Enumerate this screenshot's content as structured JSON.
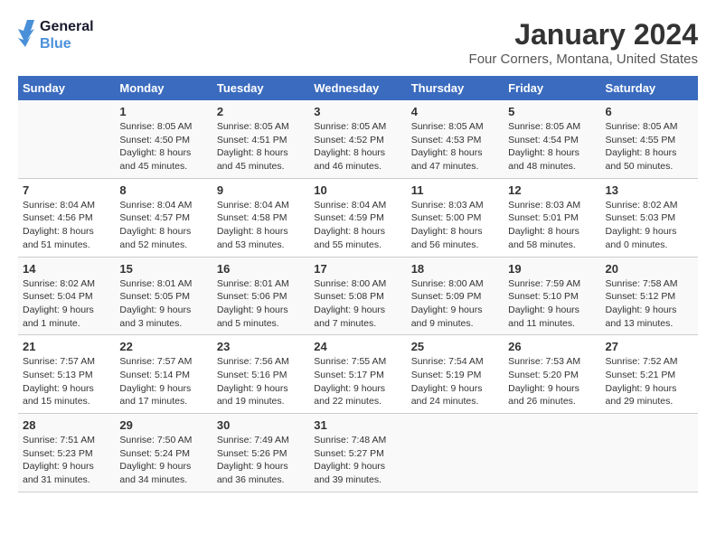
{
  "header": {
    "logo_line1": "General",
    "logo_line2": "Blue",
    "title": "January 2024",
    "subtitle": "Four Corners, Montana, United States"
  },
  "weekdays": [
    "Sunday",
    "Monday",
    "Tuesday",
    "Wednesday",
    "Thursday",
    "Friday",
    "Saturday"
  ],
  "weeks": [
    [
      {
        "day": "",
        "info": ""
      },
      {
        "day": "1",
        "info": "Sunrise: 8:05 AM\nSunset: 4:50 PM\nDaylight: 8 hours\nand 45 minutes."
      },
      {
        "day": "2",
        "info": "Sunrise: 8:05 AM\nSunset: 4:51 PM\nDaylight: 8 hours\nand 45 minutes."
      },
      {
        "day": "3",
        "info": "Sunrise: 8:05 AM\nSunset: 4:52 PM\nDaylight: 8 hours\nand 46 minutes."
      },
      {
        "day": "4",
        "info": "Sunrise: 8:05 AM\nSunset: 4:53 PM\nDaylight: 8 hours\nand 47 minutes."
      },
      {
        "day": "5",
        "info": "Sunrise: 8:05 AM\nSunset: 4:54 PM\nDaylight: 8 hours\nand 48 minutes."
      },
      {
        "day": "6",
        "info": "Sunrise: 8:05 AM\nSunset: 4:55 PM\nDaylight: 8 hours\nand 50 minutes."
      }
    ],
    [
      {
        "day": "7",
        "info": "Sunrise: 8:04 AM\nSunset: 4:56 PM\nDaylight: 8 hours\nand 51 minutes."
      },
      {
        "day": "8",
        "info": "Sunrise: 8:04 AM\nSunset: 4:57 PM\nDaylight: 8 hours\nand 52 minutes."
      },
      {
        "day": "9",
        "info": "Sunrise: 8:04 AM\nSunset: 4:58 PM\nDaylight: 8 hours\nand 53 minutes."
      },
      {
        "day": "10",
        "info": "Sunrise: 8:04 AM\nSunset: 4:59 PM\nDaylight: 8 hours\nand 55 minutes."
      },
      {
        "day": "11",
        "info": "Sunrise: 8:03 AM\nSunset: 5:00 PM\nDaylight: 8 hours\nand 56 minutes."
      },
      {
        "day": "12",
        "info": "Sunrise: 8:03 AM\nSunset: 5:01 PM\nDaylight: 8 hours\nand 58 minutes."
      },
      {
        "day": "13",
        "info": "Sunrise: 8:02 AM\nSunset: 5:03 PM\nDaylight: 9 hours\nand 0 minutes."
      }
    ],
    [
      {
        "day": "14",
        "info": "Sunrise: 8:02 AM\nSunset: 5:04 PM\nDaylight: 9 hours\nand 1 minute."
      },
      {
        "day": "15",
        "info": "Sunrise: 8:01 AM\nSunset: 5:05 PM\nDaylight: 9 hours\nand 3 minutes."
      },
      {
        "day": "16",
        "info": "Sunrise: 8:01 AM\nSunset: 5:06 PM\nDaylight: 9 hours\nand 5 minutes."
      },
      {
        "day": "17",
        "info": "Sunrise: 8:00 AM\nSunset: 5:08 PM\nDaylight: 9 hours\nand 7 minutes."
      },
      {
        "day": "18",
        "info": "Sunrise: 8:00 AM\nSunset: 5:09 PM\nDaylight: 9 hours\nand 9 minutes."
      },
      {
        "day": "19",
        "info": "Sunrise: 7:59 AM\nSunset: 5:10 PM\nDaylight: 9 hours\nand 11 minutes."
      },
      {
        "day": "20",
        "info": "Sunrise: 7:58 AM\nSunset: 5:12 PM\nDaylight: 9 hours\nand 13 minutes."
      }
    ],
    [
      {
        "day": "21",
        "info": "Sunrise: 7:57 AM\nSunset: 5:13 PM\nDaylight: 9 hours\nand 15 minutes."
      },
      {
        "day": "22",
        "info": "Sunrise: 7:57 AM\nSunset: 5:14 PM\nDaylight: 9 hours\nand 17 minutes."
      },
      {
        "day": "23",
        "info": "Sunrise: 7:56 AM\nSunset: 5:16 PM\nDaylight: 9 hours\nand 19 minutes."
      },
      {
        "day": "24",
        "info": "Sunrise: 7:55 AM\nSunset: 5:17 PM\nDaylight: 9 hours\nand 22 minutes."
      },
      {
        "day": "25",
        "info": "Sunrise: 7:54 AM\nSunset: 5:19 PM\nDaylight: 9 hours\nand 24 minutes."
      },
      {
        "day": "26",
        "info": "Sunrise: 7:53 AM\nSunset: 5:20 PM\nDaylight: 9 hours\nand 26 minutes."
      },
      {
        "day": "27",
        "info": "Sunrise: 7:52 AM\nSunset: 5:21 PM\nDaylight: 9 hours\nand 29 minutes."
      }
    ],
    [
      {
        "day": "28",
        "info": "Sunrise: 7:51 AM\nSunset: 5:23 PM\nDaylight: 9 hours\nand 31 minutes."
      },
      {
        "day": "29",
        "info": "Sunrise: 7:50 AM\nSunset: 5:24 PM\nDaylight: 9 hours\nand 34 minutes."
      },
      {
        "day": "30",
        "info": "Sunrise: 7:49 AM\nSunset: 5:26 PM\nDaylight: 9 hours\nand 36 minutes."
      },
      {
        "day": "31",
        "info": "Sunrise: 7:48 AM\nSunset: 5:27 PM\nDaylight: 9 hours\nand 39 minutes."
      },
      {
        "day": "",
        "info": ""
      },
      {
        "day": "",
        "info": ""
      },
      {
        "day": "",
        "info": ""
      }
    ]
  ]
}
